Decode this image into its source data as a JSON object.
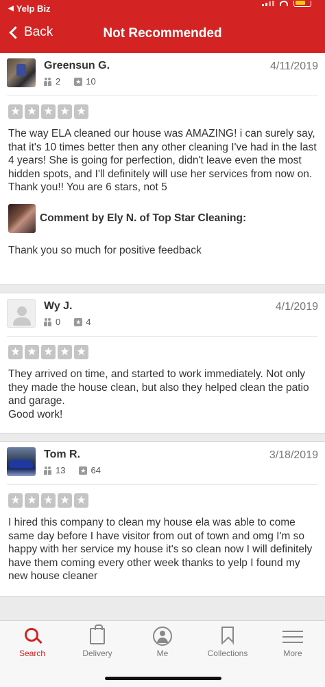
{
  "status_bar": {
    "back_app": "Yelp Biz"
  },
  "header": {
    "back_label": "Back",
    "title": "Not Recommended"
  },
  "reviews": [
    {
      "name": "Greensun G.",
      "date": "4/11/2019",
      "friends": "2",
      "review_count": "10",
      "rating": 5,
      "text": "The way ELA cleaned our house was AMAZING! i can surely say, that it's 10 times better then any other cleaning I've had in the last 4 years! She is going for perfection, didn't leave even the most hidden spots, and I'll definitely will use her services from now on.\nThank you!! You are 6 stars, not 5",
      "comment_title": "Comment by Ely N. of Top Star Cleaning:",
      "comment_text": "Thank you so much for positive feedback"
    },
    {
      "name": "Wy J.",
      "date": "4/1/2019",
      "friends": "0",
      "review_count": "4",
      "rating": 5,
      "text": "They arrived on time, and started to work immediately. Not only they made the house clean, but also they helped clean the patio and garage.\nGood work!"
    },
    {
      "name": "Tom R.",
      "date": "3/18/2019",
      "friends": "13",
      "review_count": "64",
      "rating": 5,
      "text": "I hired this company to clean my house ela was able to come same day before I have visitor from out of town and omg I'm so happy with her service my house it's so clean now I will definitely have them coming every other week thanks to yelp I found my new house cleaner"
    }
  ],
  "tabs": [
    {
      "label": "Search",
      "icon": "search-icon",
      "active": true
    },
    {
      "label": "Delivery",
      "icon": "delivery-bag-icon",
      "active": false
    },
    {
      "label": "Me",
      "icon": "user-icon",
      "active": false
    },
    {
      "label": "Collections",
      "icon": "bookmark-icon",
      "active": false
    },
    {
      "label": "More",
      "icon": "menu-icon",
      "active": false
    }
  ],
  "colors": {
    "brand": "#d32323",
    "star_empty": "#c5c5c5"
  }
}
